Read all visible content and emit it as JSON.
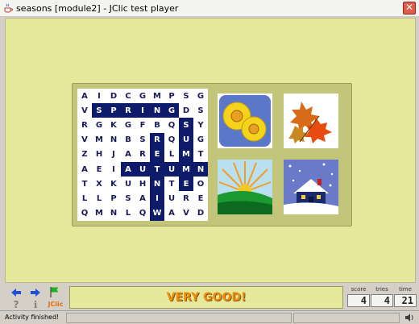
{
  "window": {
    "title": "seasons [module2] - JClic test player",
    "close_glyph": "✕"
  },
  "wordsearch": {
    "rows": [
      [
        "A",
        "I",
        "D",
        "C",
        "G",
        "M",
        "P",
        "S",
        "G"
      ],
      [
        "V",
        "S",
        "P",
        "R",
        "I",
        "N",
        "G",
        "D",
        "S"
      ],
      [
        "R",
        "G",
        "K",
        "G",
        "F",
        "B",
        "Q",
        "S",
        "Y"
      ],
      [
        "V",
        "M",
        "N",
        "B",
        "S",
        "R",
        "Q",
        "U",
        "G"
      ],
      [
        "Z",
        "H",
        "J",
        "A",
        "R",
        "E",
        "L",
        "M",
        "T"
      ],
      [
        "A",
        "E",
        "I",
        "A",
        "U",
        "T",
        "U",
        "M",
        "N"
      ],
      [
        "T",
        "X",
        "K",
        "U",
        "H",
        "N",
        "T",
        "E",
        "O"
      ],
      [
        "L",
        "L",
        "P",
        "S",
        "A",
        "I",
        "U",
        "R",
        "E"
      ],
      [
        "Q",
        "M",
        "N",
        "L",
        "Q",
        "W",
        "A",
        "V",
        "D"
      ]
    ],
    "highlighted": [
      [
        1,
        1
      ],
      [
        1,
        2
      ],
      [
        1,
        3
      ],
      [
        1,
        4
      ],
      [
        1,
        5
      ],
      [
        1,
        6
      ],
      [
        2,
        7
      ],
      [
        3,
        7
      ],
      [
        4,
        7
      ],
      [
        5,
        7
      ],
      [
        6,
        7
      ],
      [
        3,
        5
      ],
      [
        4,
        5
      ],
      [
        5,
        5
      ],
      [
        6,
        5
      ],
      [
        7,
        5
      ],
      [
        8,
        5
      ],
      [
        5,
        3
      ],
      [
        5,
        4
      ],
      [
        5,
        6
      ],
      [
        5,
        8
      ]
    ],
    "highlight_color": "#0e1a6a"
  },
  "tiles": [
    {
      "icon": "sunflowers-icon"
    },
    {
      "icon": "autumn-leaves-icon"
    },
    {
      "icon": "sunrise-icon"
    },
    {
      "icon": "winter-house-icon"
    }
  ],
  "controls": {
    "prev_icon": "back-arrow-icon",
    "next_icon": "forward-arrow-icon",
    "flag_icon": "flag-icon",
    "help_glyph": "?",
    "info_glyph": "ℹ",
    "jclic_label": "JClic"
  },
  "message": "VERY GOOD!",
  "counters": {
    "score_label": "score",
    "score": "4",
    "tries_label": "tries",
    "tries": "4",
    "time_label": "time",
    "time": "21"
  },
  "status": {
    "text": "Activity finished!"
  }
}
